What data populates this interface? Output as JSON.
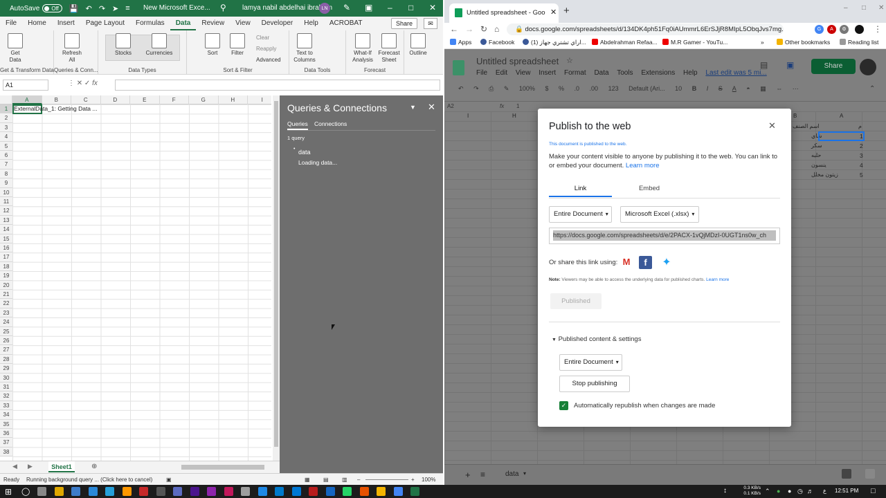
{
  "excel": {
    "autosave_label": "AutoSave",
    "autosave_state": "Off",
    "filename": "New Microsoft Exce...",
    "user": "lamya nabil abdelhai ibrahem",
    "user_initials": "LN",
    "tabs": [
      "File",
      "Home",
      "Insert",
      "Page Layout",
      "Formulas",
      "Data",
      "Review",
      "View",
      "Developer",
      "Help",
      "ACROBAT"
    ],
    "active_tab": "Data",
    "share_label": "Share",
    "ribbon": {
      "get_data": "Get Data",
      "refresh_all": "Refresh All",
      "stocks": "Stocks",
      "currencies": "Currencies",
      "sort": "Sort",
      "filter": "Filter",
      "clear": "Clear",
      "reapply": "Reapply",
      "advanced": "Advanced",
      "text_to_columns": "Text to Columns",
      "what_if": "What-If Analysis",
      "forecast_sheet": "Forecast Sheet",
      "outline": "Outline",
      "groups": [
        "Get & Transform Data",
        "Queries & Conn...",
        "Data Types",
        "Sort & Filter",
        "Data Tools",
        "Forecast"
      ]
    },
    "name_box": "A1",
    "columns": [
      "A",
      "B",
      "C",
      "D",
      "E",
      "F",
      "G",
      "H",
      "I"
    ],
    "rows": [
      "1",
      "2",
      "3",
      "4",
      "5",
      "6",
      "7",
      "8",
      "9",
      "10",
      "11",
      "12",
      "13",
      "14",
      "15",
      "16",
      "17",
      "18",
      "19",
      "20",
      "21",
      "22",
      "23",
      "24",
      "25",
      "26",
      "27",
      "28",
      "29",
      "30",
      "31",
      "32",
      "33",
      "34",
      "35",
      "36",
      "37",
      "38"
    ],
    "cell_a1": "ExternalData_1: Getting Data ...",
    "sheet_tab": "Sheet1",
    "status_ready": "Ready",
    "status_query": "Running background query ... (Click here to cancel)",
    "zoom": "100%",
    "queries_pane": {
      "title": "Queries & Connections",
      "tab_queries": "Queries",
      "tab_connections": "Connections",
      "count": "1 query",
      "query_name": "data",
      "loading": "Loading data..."
    }
  },
  "chrome": {
    "tab_title": "Untitled spreadsheet - Google S...",
    "url": "docs.google.com/spreadsheets/d/134DK4ph51Fq0iAUmmrL6ErSJjR8MIpL5ObqJvs7mg...",
    "bookmarks": [
      "Apps",
      "Facebook",
      "(1) اراي تشتري جهاز...",
      "Abdelrahman Refaa...",
      "M.R Gamer - YouTu..."
    ],
    "other_bookmarks": "Other bookmarks",
    "reading_list": "Reading list",
    "sheets": {
      "title": "Untitled spreadsheet",
      "menu": [
        "File",
        "Edit",
        "View",
        "Insert",
        "Format",
        "Data",
        "Tools",
        "Extensions",
        "Help"
      ],
      "last_edit": "Last edit was 5 mi...",
      "share_label": "Share",
      "zoom": "100%",
      "font": "Default (Ari...",
      "font_size": "10",
      "toolbar_symbols": [
        "$",
        "%",
        ".0",
        ".00",
        "123"
      ],
      "cell_ref": "A2",
      "formula_value": "1",
      "col_labels": [
        "H",
        "I",
        "B",
        "A"
      ],
      "header_text": "اسم الصنف",
      "header_num": "م",
      "items": [
        "شاي",
        "سكر",
        "حلبه",
        "ينسون",
        "زيتون مخلل"
      ],
      "numbers": [
        "1",
        "2",
        "3",
        "4",
        "5"
      ],
      "sheet_tab": "data"
    },
    "dialog": {
      "title": "Publish to the web",
      "published_note": "This document is published to the web.",
      "description": "Make your content visible to anyone by publishing it to the web. You can link to or embed your document.",
      "learn_more": "Learn more",
      "tab_link": "Link",
      "tab_embed": "Embed",
      "dd_document": "Entire Document",
      "dd_format": "Microsoft Excel (.xlsx)",
      "published_url": "https://docs.google.com/spreadsheets/d/e/2PACX-1vQjMDzI-0UGT1ns0w_ch",
      "share_label": "Or share this link using:",
      "note_bold": "Note:",
      "note_text": "Viewers may be able to access the underlying data for published charts.",
      "note_link": "Learn more",
      "published_button": "Published",
      "settings_label": "Published content & settings",
      "dd_document2": "Entire Document",
      "stop_button": "Stop publishing",
      "auto_label": "Automatically republish when changes are made"
    }
  },
  "taskbar": {
    "net_up": "0.3 KB/s",
    "net_down": "0.1 KB/s",
    "lang": "ع",
    "time": "12:51 PM"
  },
  "colors": {
    "excel_green": "#217346",
    "sheets_green": "#0f9d58",
    "google_blue": "#1a73e8",
    "pane_gray": "#6e6e6e"
  }
}
